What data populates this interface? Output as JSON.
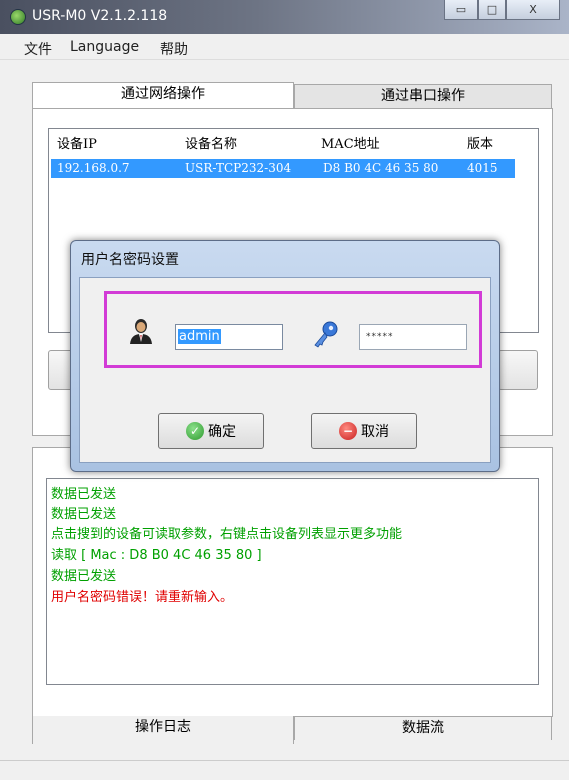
{
  "window": {
    "title": "USR-M0 V2.1.2.118",
    "minimize": "▭",
    "maximize": "□",
    "close": "X"
  },
  "menu": [
    "文件",
    "Language",
    "帮助"
  ],
  "top_tabs": [
    {
      "label": "通过网络操作",
      "active": true
    },
    {
      "label": "通过串口操作",
      "active": false
    }
  ],
  "device_table": {
    "columns": [
      "设备IP",
      "设备名称",
      "MAC地址",
      "版本"
    ],
    "rows": [
      {
        "ip": "192.168.0.7",
        "name": "USR-TCP232-304",
        "mac": "D8 B0 4C 46 35 80",
        "version": "4015"
      }
    ]
  },
  "dialog": {
    "title": "用户名密码设置",
    "username_value": "admin",
    "password_mask": "*****",
    "ok_label": "确定",
    "cancel_label": "取消"
  },
  "log": {
    "lines": [
      {
        "text": "数据已发送",
        "color": "#00a000"
      },
      {
        "text": "数据已发送",
        "color": "#00a000"
      },
      {
        "text": "点击搜到的设备可读取参数，右键点击设备列表显示更多功能",
        "color": "#00a000"
      },
      {
        "text": "读取 [ Mac : D8 B0 4C 46 35 80 ]",
        "color": "#00a000"
      },
      {
        "text": "数据已发送",
        "color": "#00a000"
      },
      {
        "text": " 用户名密码错误！请重新输入。",
        "color": "#e00000"
      }
    ]
  },
  "bottom_tabs": [
    {
      "label": "操作日志",
      "active": true
    },
    {
      "label": "数据流",
      "active": false
    }
  ],
  "colors": {
    "selection": "#3399ff",
    "highlight_box": "#d23bd6",
    "log_green": "#00a000",
    "log_red": "#e00000"
  }
}
